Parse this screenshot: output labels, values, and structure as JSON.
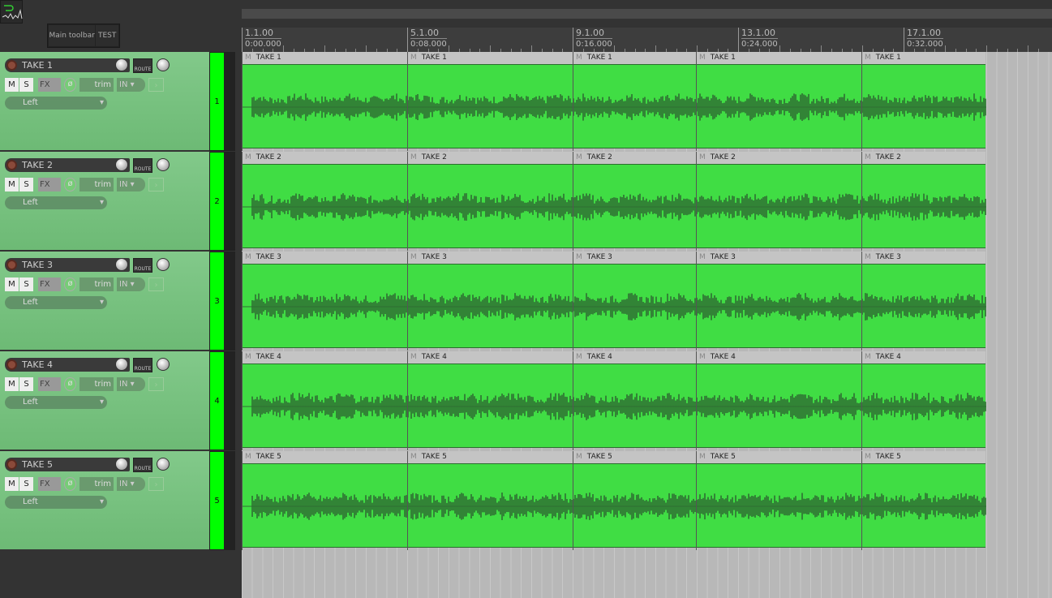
{
  "toolbar": {
    "main": "Main toolbar",
    "test": "TEST"
  },
  "ruler": [
    {
      "bar": "1.1.00",
      "time": "0:00.000"
    },
    {
      "bar": "5.1.00",
      "time": "0:08.000"
    },
    {
      "bar": "9.1.00",
      "time": "0:16.000"
    },
    {
      "bar": "13.1.00",
      "time": "0:24.000"
    },
    {
      "bar": "17.1.00",
      "time": "0:32.000"
    }
  ],
  "tcp": {
    "mute": "M",
    "solo": "S",
    "fx": "FX",
    "trim": "trim",
    "input": "IN",
    "route": "ROUTE",
    "item_mute": "M"
  },
  "colors": {
    "track": "#00ff00",
    "item": "#40dd44",
    "waveform": "#2f6e33"
  },
  "tracks": [
    {
      "name": "TAKE 1",
      "number": "1",
      "pan": "Left"
    },
    {
      "name": "TAKE 2",
      "number": "2",
      "pan": "Left"
    },
    {
      "name": "TAKE 3",
      "number": "3",
      "pan": "Left"
    },
    {
      "name": "TAKE 4",
      "number": "4",
      "pan": "Left"
    },
    {
      "name": "TAKE 5",
      "number": "5",
      "pan": "Left"
    }
  ]
}
